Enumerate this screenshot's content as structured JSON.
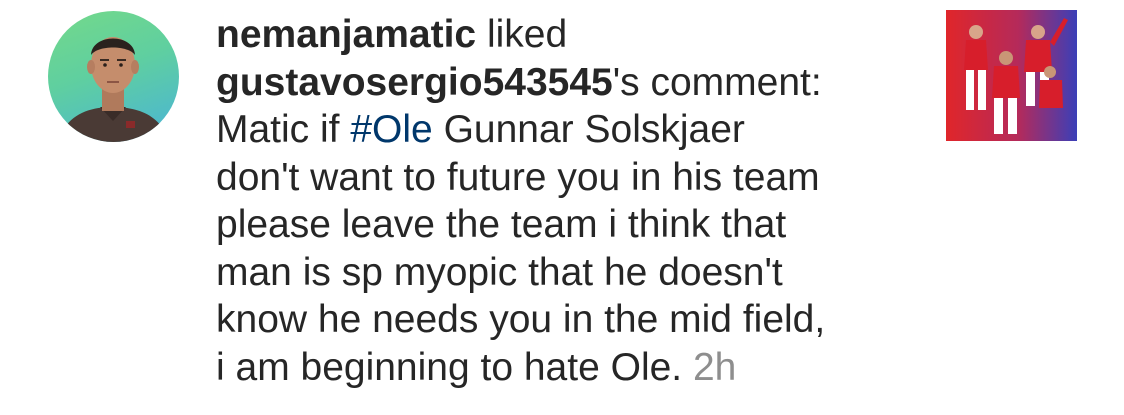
{
  "notification": {
    "actor_username": "nemanjamatic",
    "action_text": " liked",
    "target_username": "gustavosergio543545",
    "target_suffix": "'s comment:",
    "comment_prefix": "Matic if ",
    "hashtag": "#Ole",
    "comment_lines": [
      " Gunnar Solskjaer",
      "don't want to future you in his team",
      "please leave the team i think that",
      "man is sp myopic that he doesn't",
      "know he needs you in the mid field,",
      "i am beginning to hate Ole. "
    ],
    "timestamp": "2h"
  },
  "colors": {
    "text": "#262626",
    "hashtag": "#00376b",
    "timestamp": "#8e8e8e",
    "avatar_bg_start": "#74d98a",
    "avatar_bg_end": "#49b3d8",
    "thumb_bg_left": "#e0262a",
    "thumb_bg_right": "#3b3fb8"
  },
  "icons": {
    "avatar": "profile-photo",
    "thumbnail": "post-thumbnail-football-players"
  }
}
